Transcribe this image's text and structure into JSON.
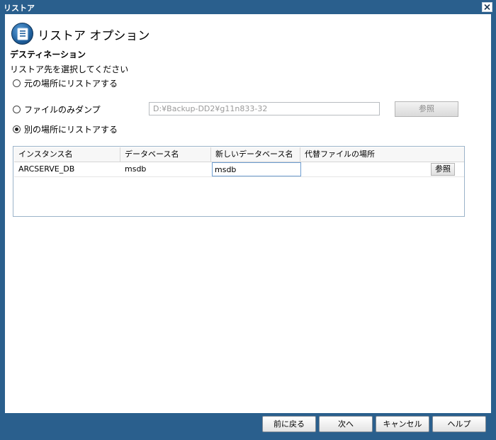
{
  "window": {
    "title": "リストア"
  },
  "header": {
    "title": "リストア オプション",
    "icon": "document-list-icon"
  },
  "destination": {
    "section_title": "デスティネーション",
    "description": "リストア先を選択してください",
    "options": [
      {
        "label": "元の場所にリストアする",
        "checked": false
      },
      {
        "label": "ファイルのみダンプ",
        "checked": false
      },
      {
        "label": "別の場所にリストアする",
        "checked": true
      }
    ],
    "dump_path": "D:¥Backup-DD2¥g11n833-32",
    "browse_label": "参照"
  },
  "grid": {
    "columns": [
      "インスタンス名",
      "データベース名",
      "新しいデータベース名",
      "代替ファイルの場所"
    ],
    "rows": [
      {
        "instance": "ARCSERVE_DB",
        "database": "msdb",
        "new_database": "msdb",
        "alt_location": "",
        "browse_label": "参照"
      }
    ]
  },
  "footer": {
    "back_label": "前に戻る",
    "next_label": "次へ",
    "cancel_label": "キャンセル",
    "help_label": "ヘルプ"
  },
  "colors": {
    "frame": "#2a5f8d",
    "accent": "#1f5f9c"
  }
}
